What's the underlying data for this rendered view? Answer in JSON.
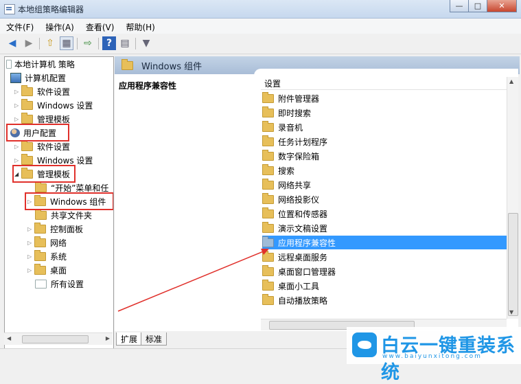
{
  "window": {
    "title": "本地组策略编辑器"
  },
  "menu": [
    "文件(F)",
    "操作(A)",
    "查看(V)",
    "帮助(H)"
  ],
  "toolbar": [
    "back-icon",
    "forward-icon",
    "up-folder-icon",
    "show-hide-tree-icon",
    "export-icon",
    "help-icon",
    "properties-icon",
    "filter-icon"
  ],
  "tree": {
    "root": "本地计算机 策略",
    "computer_config": "计算机配置",
    "cc_software": "软件设置",
    "cc_windows": "Windows 设置",
    "cc_admin": "管理模板",
    "user_config": "用户配置",
    "uc_software": "软件设置",
    "uc_windows": "Windows 设置",
    "uc_admin": "管理模板",
    "start_menu": "“开始”菜单和任",
    "win_components": "Windows 组件",
    "shared_folders": "共享文件夹",
    "control_panel": "控制面板",
    "network": "网络",
    "system": "系统",
    "desktop": "桌面",
    "all_settings": "所有设置"
  },
  "header": {
    "title": "Windows 组件"
  },
  "detail": {
    "title": "应用程序兼容性"
  },
  "list": {
    "column": "设置",
    "items": [
      "附件管理器",
      "即时搜索",
      "录音机",
      "任务计划程序",
      "数字保险箱",
      "搜索",
      "网络共享",
      "网络投影仪",
      "位置和传感器",
      "演示文稿设置",
      "应用程序兼容性",
      "远程桌面服务",
      "桌面窗口管理器",
      "桌面小工具",
      "自动播放策略"
    ],
    "selected_index": 10
  },
  "tabs": [
    "扩展",
    "标准"
  ],
  "watermark": {
    "title": "白云一键重装系统",
    "url": "www.baiyunxitong.com"
  },
  "colors": {
    "selection": "#3399ff",
    "highlight_box": "#e0302b",
    "header": "#b3c6dd",
    "brand": "#1f96e6"
  }
}
